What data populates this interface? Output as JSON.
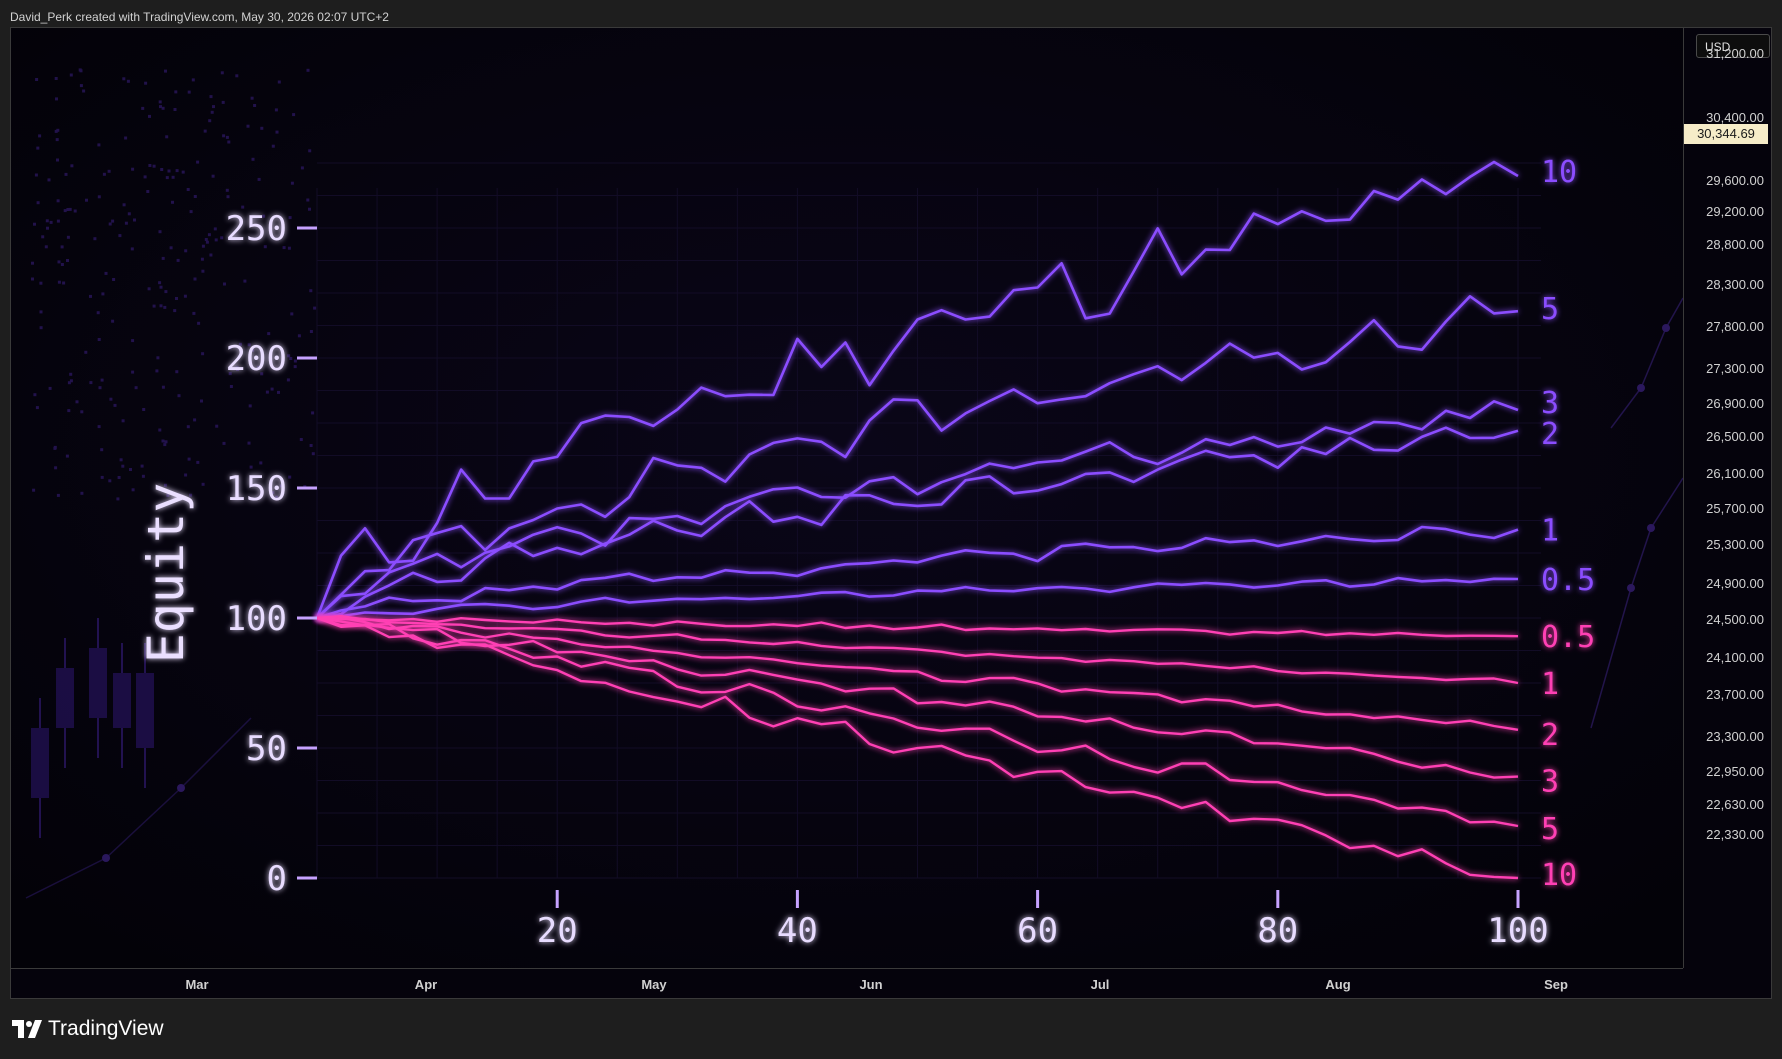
{
  "header": {
    "attribution": "David_Perk created with TradingView.com, May 30, 2026 02:07 UTC+2"
  },
  "price_scale": {
    "currency": "USD",
    "last_price": "30,344.69",
    "labels": [
      "31,200.00",
      "30,400.00",
      "29,600.00",
      "29,200.00",
      "28,800.00",
      "28,300.00",
      "27,800.00",
      "27,300.00",
      "26,900.00",
      "26,500.00",
      "26,100.00",
      "25,700.00",
      "25,300.00",
      "24,900.00",
      "24,500.00",
      "24,100.00",
      "23,700.00",
      "23,300.00",
      "22,950.00",
      "22,630.00",
      "22,330.00"
    ]
  },
  "time_axis": {
    "labels": [
      "Mar",
      "Apr",
      "May",
      "Jun",
      "Jul",
      "Aug",
      "Sep"
    ]
  },
  "footer": {
    "brand": "TradingView"
  },
  "colors": {
    "growth": "#8b4dff",
    "decline": "#ff3fb4",
    "axis": "#c6a2ff",
    "background": "#05030c"
  },
  "chart_data": {
    "type": "line",
    "ylabel": "Equity",
    "xlabel": "",
    "xlim": [
      0,
      100
    ],
    "ylim": [
      0,
      270
    ],
    "x_ticks": [
      "20",
      "40",
      "60",
      "80",
      "100"
    ],
    "y_ticks": [
      "0",
      "50",
      "100",
      "150",
      "200",
      "250"
    ],
    "start": {
      "x": 0,
      "y": 100
    },
    "series": [
      {
        "name": "10",
        "group": "up",
        "end": 270
      },
      {
        "name": "5",
        "group": "up",
        "end": 218
      },
      {
        "name": "3",
        "group": "up",
        "end": 180
      },
      {
        "name": "2",
        "group": "up",
        "end": 172
      },
      {
        "name": "1",
        "group": "up",
        "end": 134
      },
      {
        "name": "0.5",
        "group": "up",
        "end": 115
      },
      {
        "name": "0.5",
        "group": "down",
        "end": 93
      },
      {
        "name": "1",
        "group": "down",
        "end": 75
      },
      {
        "name": "2",
        "group": "down",
        "end": 57
      },
      {
        "name": "3",
        "group": "down",
        "end": 39
      },
      {
        "name": "5",
        "group": "down",
        "end": 20
      },
      {
        "name": "10",
        "group": "down",
        "end": 0
      }
    ]
  }
}
